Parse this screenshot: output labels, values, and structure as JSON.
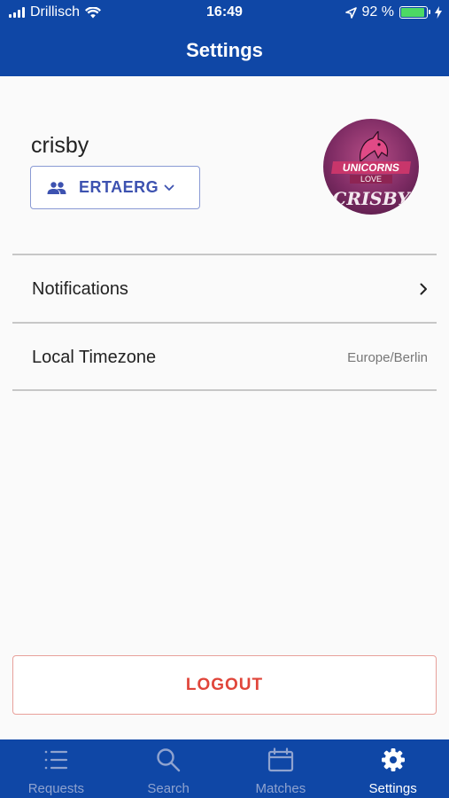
{
  "status_bar": {
    "carrier": "Drillisch",
    "time": "16:49",
    "battery_percent": "92 %",
    "battery_level": 0.92,
    "icons": [
      "signal-icon",
      "wifi-icon",
      "location-arrow-icon",
      "battery-icon",
      "charging-bolt-icon"
    ]
  },
  "header": {
    "title": "Settings"
  },
  "profile": {
    "username": "crisby",
    "team_name": "ERTAERG",
    "team_icon": "people-icon",
    "avatar": {
      "logo_line1": "UNICORNS",
      "logo_line2": "LOVE",
      "signature": "CRISBY"
    }
  },
  "settings": {
    "notifications_label": "Notifications",
    "timezone_label": "Local Timezone",
    "timezone_value": "Europe/Berlin"
  },
  "logout_label": "LOGOUT",
  "tabs": [
    {
      "label": "Requests",
      "icon": "list-icon",
      "active": false
    },
    {
      "label": "Search",
      "icon": "search-icon",
      "active": false
    },
    {
      "label": "Matches",
      "icon": "calendar-icon",
      "active": false
    },
    {
      "label": "Settings",
      "icon": "gear-icon",
      "active": true
    }
  ],
  "colors": {
    "primary": "#0f47a6",
    "accent": "#3d52b0",
    "danger": "#e0453a",
    "battery_fill": "#4cd964"
  }
}
